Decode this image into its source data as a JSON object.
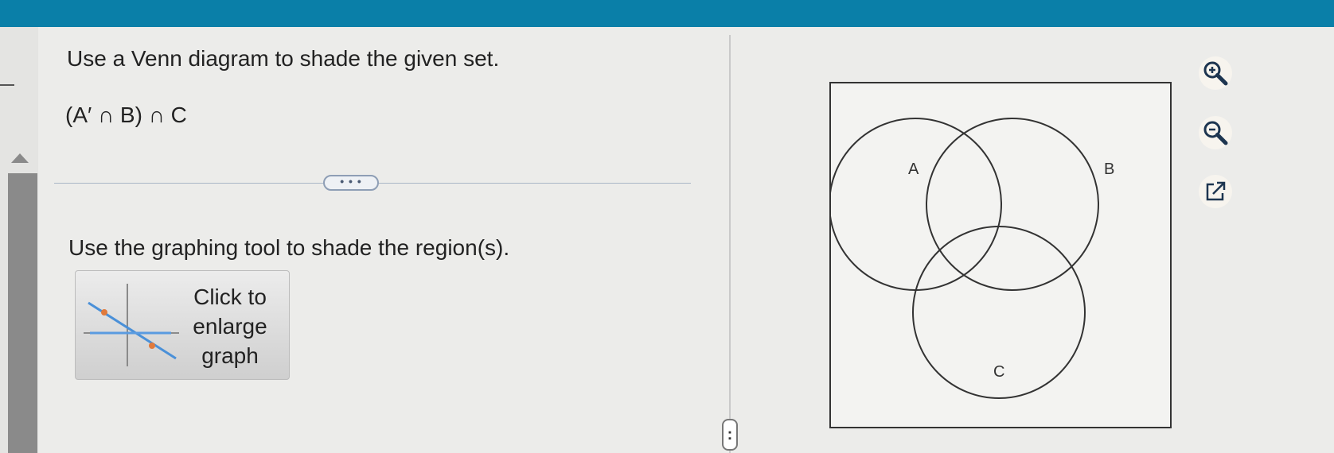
{
  "question": {
    "instruction": "Use a Venn diagram to shade the given set.",
    "expression": "(A′ ∩ B) ∩ C",
    "more_button_label": "• • •",
    "graph_instruction": "Use the graphing tool to shade the region(s).",
    "enlarge_button": {
      "line1": "Click to",
      "line2": "enlarge",
      "line3": "graph"
    }
  },
  "divider_handle_label": ":",
  "venn": {
    "labels": {
      "a": "A",
      "b": "B",
      "c": "C"
    }
  },
  "tools": [
    {
      "name": "zoom-in-icon"
    },
    {
      "name": "zoom-out-icon"
    },
    {
      "name": "external-link-icon"
    }
  ],
  "colors": {
    "top_bar": "#0a7fa8",
    "enlarge_graph_marker": "#e07a3c",
    "enlarge_graph_line": "#4a90d8"
  }
}
